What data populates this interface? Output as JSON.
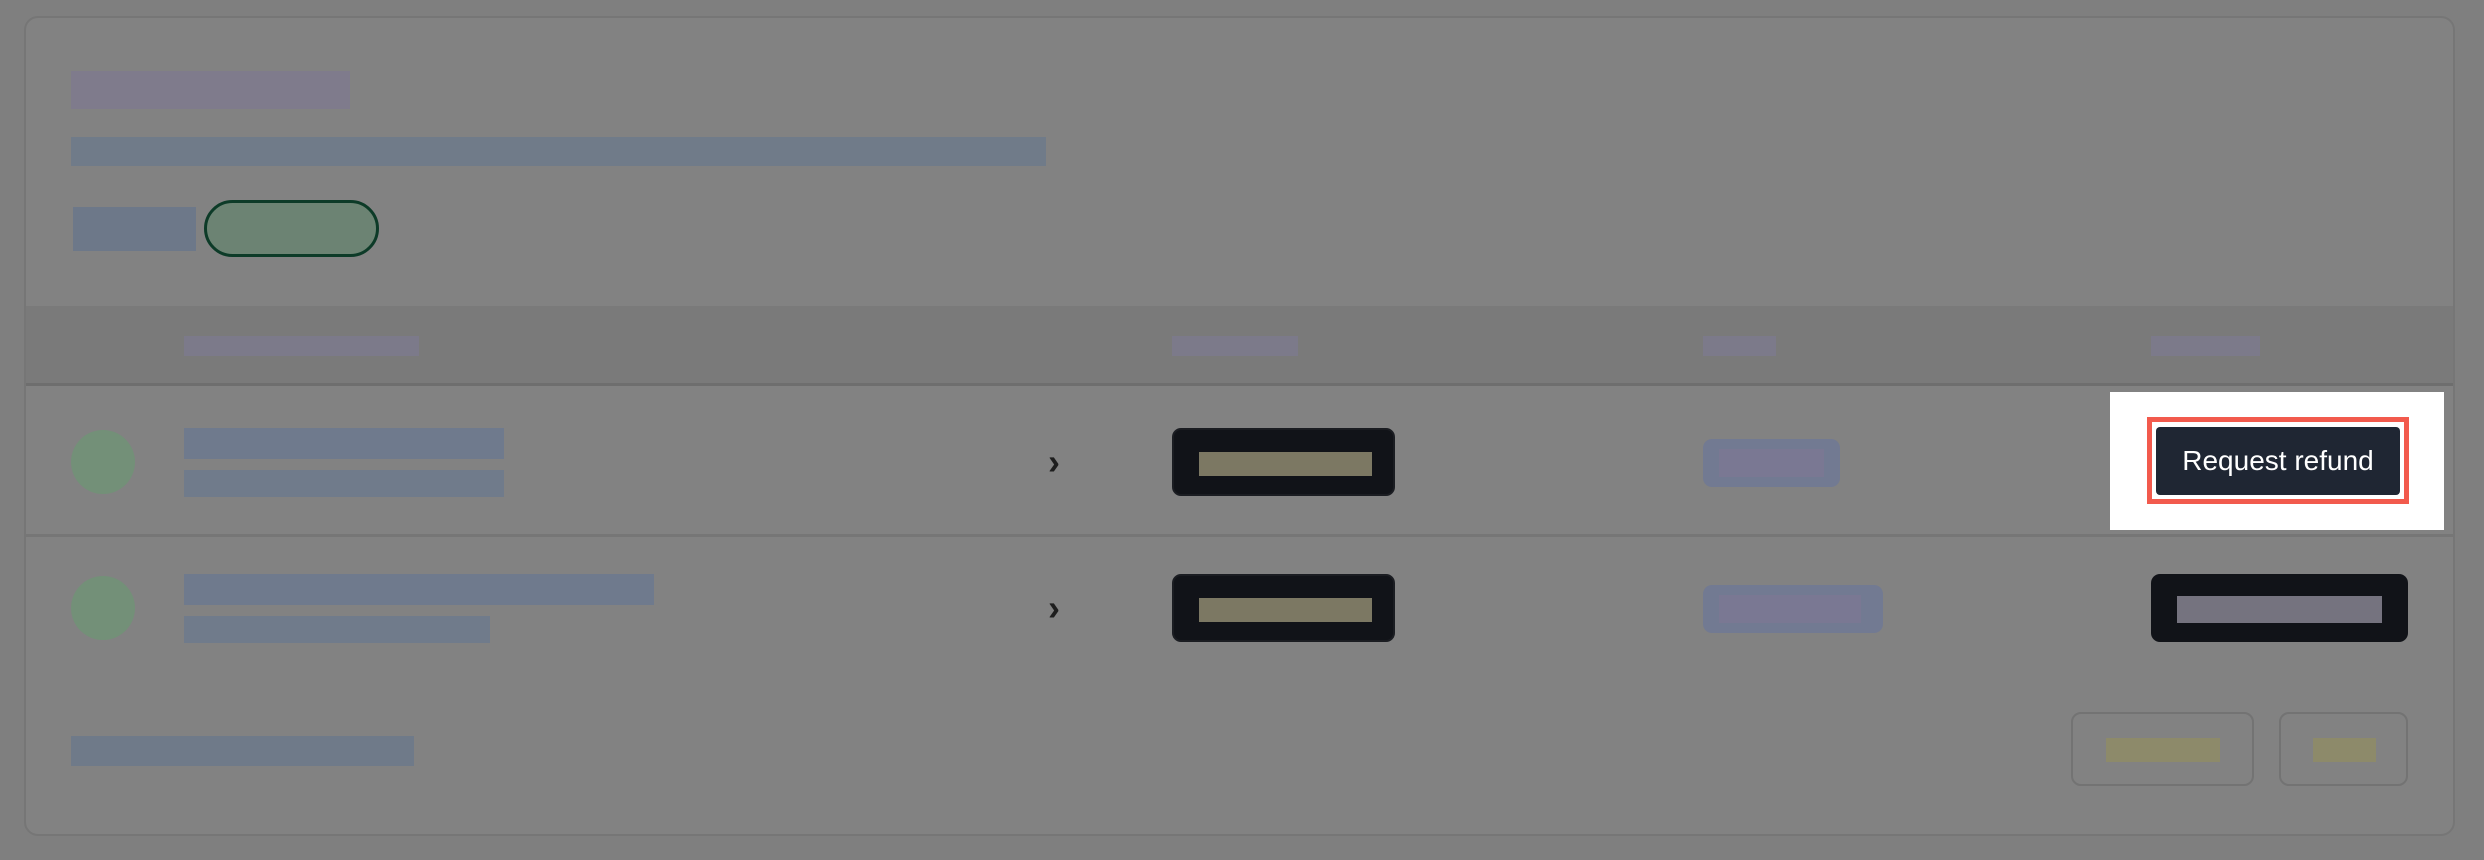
{
  "window": {
    "background": "#7f7f7f"
  },
  "table": {
    "rows": [
      {
        "chevron": "›",
        "action_label": "Request refund"
      },
      {
        "chevron": "›"
      }
    ]
  },
  "highlight": {
    "target": "request-refund-button",
    "ring_color": "#f25a4d",
    "button_color": "#1f2633"
  },
  "icons": {
    "row_chevron": "chevron-right-icon"
  }
}
